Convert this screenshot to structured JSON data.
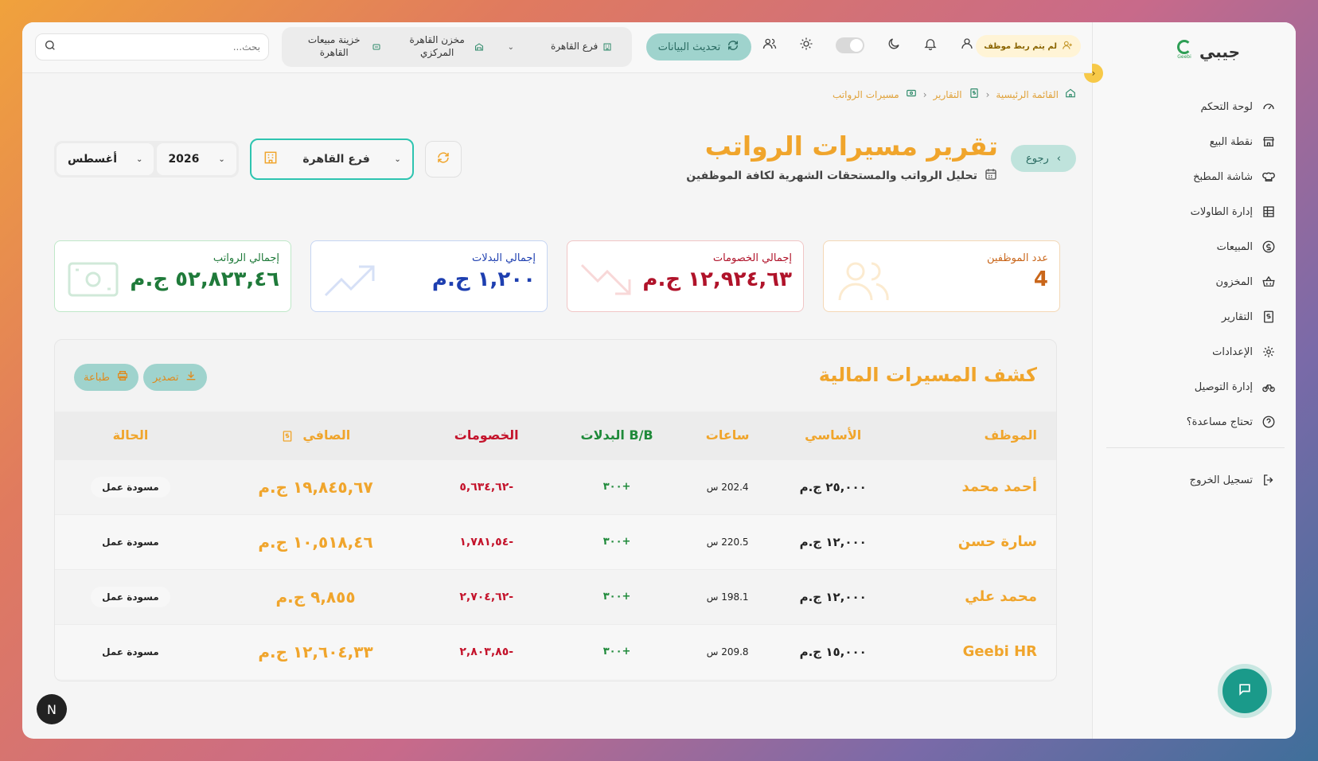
{
  "brand": {
    "name": "جيبي",
    "logo_text": "Geebi"
  },
  "sidebar": {
    "items": [
      {
        "label": "لوحة التحكم",
        "icon": "gauge-icon"
      },
      {
        "label": "نقطة البيع",
        "icon": "store-icon"
      },
      {
        "label": "شاشة المطبخ",
        "icon": "chef-hat-icon"
      },
      {
        "label": "إدارة الطاولات",
        "icon": "table-grid-icon"
      },
      {
        "label": "المبيعات",
        "icon": "dollar-circle-icon"
      },
      {
        "label": "المخزون",
        "icon": "basket-icon"
      },
      {
        "label": "التقارير",
        "icon": "report-icon"
      },
      {
        "label": "الإعدادات",
        "icon": "gear-icon"
      },
      {
        "label": "إدارة التوصيل",
        "icon": "bike-icon"
      },
      {
        "label": "تحتاج مساعدة؟",
        "icon": "help-icon"
      }
    ],
    "logout": "تسجيل الخروج"
  },
  "topbar": {
    "unlinked_badge": "لم يتم ربط موظف",
    "refresh_label": "تحديث البيانات",
    "branch": "فرع القاهرة",
    "warehouse": "مخزن القاهرة المركزي",
    "cashbox": "خزينة مبيعات القاهرة",
    "search_placeholder": "بحث..."
  },
  "breadcrumb": {
    "home": "القائمة الرئيسية",
    "reports": "التقارير",
    "current": "مسيرات الرواتب"
  },
  "header": {
    "back_label": "رجوع",
    "title": "تقرير مسيرات الرواتب",
    "subtitle": "تحليل الرواتب والمستحقات الشهرية لكافة الموظفين"
  },
  "filters": {
    "month": "أغسطس",
    "year": "2026",
    "branch": "فرع القاهرة"
  },
  "stats": {
    "salaries": {
      "label": "إجمالي الرواتب",
      "value": "٥٢,٨٢٣,٤٦ ج.م"
    },
    "allowances": {
      "label": "إجمالي البدلات",
      "value": "١,٢٠٠ ج.م"
    },
    "deductions": {
      "label": "إجمالي الخصومات",
      "value": "١٢,٩٢٤,٦٣ ج.م"
    },
    "employees": {
      "label": "عدد الموظفين",
      "value": "4"
    }
  },
  "sheet": {
    "title": "كشف المسيرات المالية",
    "export_label": "تصدير",
    "print_label": "طباعة",
    "columns": {
      "employee": "الموظف",
      "basic": "الأساسي",
      "hours": "ساعات",
      "allowances": "B/B البدلات",
      "deductions": "الخصومات",
      "net": "الصافي",
      "status": "الحالة"
    },
    "rows": [
      {
        "employee": "أحمد محمد",
        "basic": "٢٥,٠٠٠ ج.م",
        "hours": "202.4 س",
        "allowances": "+٣٠٠",
        "deductions": "-٥,٦٣٤,٦٢",
        "net": "١٩,٨٤٥,٦٧ ج.م",
        "status": "مسودة عمل"
      },
      {
        "employee": "سارة حسن",
        "basic": "١٢,٠٠٠ ج.م",
        "hours": "220.5 س",
        "allowances": "+٣٠٠",
        "deductions": "-١,٧٨١,٥٤",
        "net": "١٠,٥١٨,٤٦ ج.م",
        "status": "مسودة عمل"
      },
      {
        "employee": "محمد علي",
        "basic": "١٢,٠٠٠ ج.م",
        "hours": "198.1 س",
        "allowances": "+٣٠٠",
        "deductions": "-٢,٧٠٤,٦٢",
        "net": "٩,٨٥٥ ج.م",
        "status": "مسودة عمل"
      },
      {
        "employee": "Geebi HR",
        "basic": "١٥,٠٠٠ ج.م",
        "hours": "209.8 س",
        "allowances": "+٣٠٠",
        "deductions": "-٢,٨٠٣,٨٥",
        "net": "١٢,٦٠٤,٣٣ ج.م",
        "status": "مسودة عمل"
      }
    ]
  },
  "fab": {
    "n_badge": "N"
  }
}
